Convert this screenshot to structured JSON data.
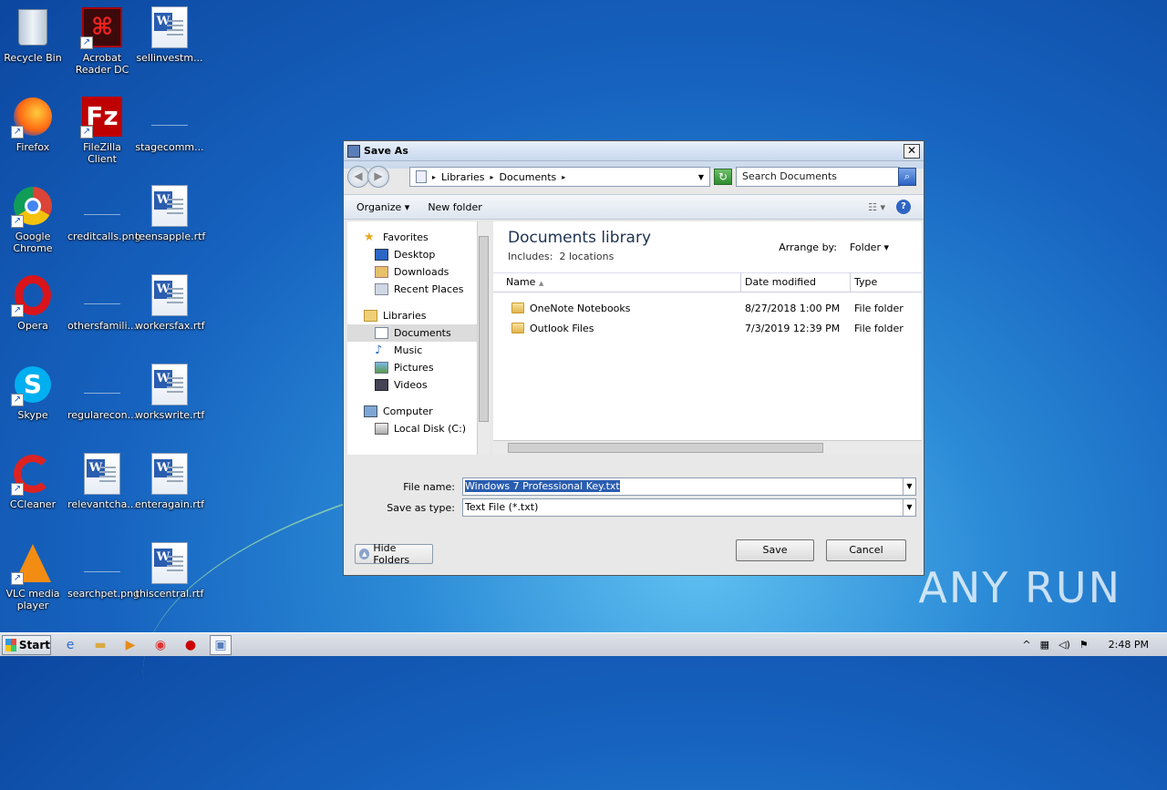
{
  "desktop": {
    "icons": [
      {
        "label": "Recycle Bin",
        "icon": "recycle-bin-icon"
      },
      {
        "label": "Acrobat Reader DC",
        "icon": "acrobat-icon"
      },
      {
        "label": "sellinvestm...",
        "icon": "word-doc-icon"
      },
      {
        "label": "Firefox",
        "icon": "firefox-icon"
      },
      {
        "label": "FileZilla Client",
        "icon": "filezilla-icon"
      },
      {
        "label": "stagecomm...",
        "icon": "blank-file-icon"
      },
      {
        "label": "Google Chrome",
        "icon": "chrome-icon"
      },
      {
        "label": "creditcalls.png",
        "icon": "blank-file-icon"
      },
      {
        "label": "teensapple.rtf",
        "icon": "word-doc-icon"
      },
      {
        "label": "Opera",
        "icon": "opera-icon"
      },
      {
        "label": "othersfamili...",
        "icon": "blank-file-icon"
      },
      {
        "label": "workersfax.rtf",
        "icon": "word-doc-icon"
      },
      {
        "label": "Skype",
        "icon": "skype-icon"
      },
      {
        "label": "regularecon...",
        "icon": "blank-file-icon"
      },
      {
        "label": "workswrite.rtf",
        "icon": "word-doc-icon"
      },
      {
        "label": "CCleaner",
        "icon": "ccleaner-icon"
      },
      {
        "label": "relevantcha...",
        "icon": "word-doc-icon"
      },
      {
        "label": "enteragain.rtf",
        "icon": "word-doc-icon"
      },
      {
        "label": "VLC media player",
        "icon": "vlc-icon"
      },
      {
        "label": "searchpet.png",
        "icon": "blank-file-icon"
      },
      {
        "label": "thiscentral.rtf",
        "icon": "word-doc-icon"
      }
    ],
    "watermark": "ANY RUN"
  },
  "dialog": {
    "title": "Save As",
    "close": "✕",
    "address": {
      "crumb1": "Libraries",
      "crumb2": "Documents",
      "search_placeholder": "Search Documents"
    },
    "toolbar": {
      "organize": "Organize",
      "new_folder": "New folder"
    },
    "nav": {
      "favorites": "Favorites",
      "desktop": "Desktop",
      "downloads": "Downloads",
      "recent": "Recent Places",
      "libraries": "Libraries",
      "documents": "Documents",
      "music": "Music",
      "pictures": "Pictures",
      "videos": "Videos",
      "computer": "Computer",
      "local_disk": "Local Disk (C:)"
    },
    "content": {
      "title": "Documents library",
      "includes_label": "Includes:",
      "includes_value": "2 locations",
      "arrange_label": "Arrange by:",
      "arrange_value": "Folder",
      "columns": {
        "name": "Name",
        "date": "Date modified",
        "type": "Type"
      },
      "rows": [
        {
          "name": "OneNote Notebooks",
          "date": "8/27/2018 1:00 PM",
          "type": "File folder"
        },
        {
          "name": "Outlook Files",
          "date": "7/3/2019 12:39 PM",
          "type": "File folder"
        }
      ]
    },
    "file_name_label": "File name:",
    "file_name_value": "Windows 7 Professional Key.txt",
    "save_type_label": "Save as type:",
    "save_type_value": "Text File  (*.txt)",
    "hide_folders": "Hide Folders",
    "save": "Save",
    "cancel": "Cancel"
  },
  "taskbar": {
    "start": "Start",
    "clock": "2:48 PM"
  }
}
